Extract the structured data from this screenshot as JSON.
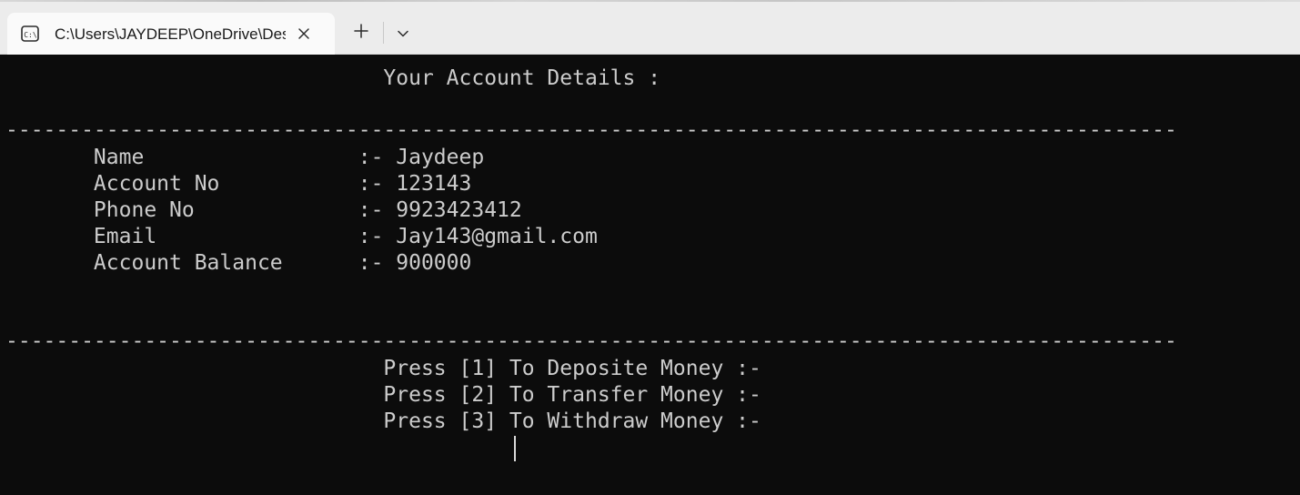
{
  "tab": {
    "title": "C:\\Users\\JAYDEEP\\OneDrive\\Desktop\\bank.exe",
    "icon": "terminal-icon"
  },
  "toolbar": {
    "new_tab_icon": "plus-icon",
    "dropdown_icon": "chevron-down-icon"
  },
  "terminal": {
    "heading": "                              Your Account Details :",
    "divider_char": "-",
    "details": [
      {
        "label": "Name",
        "value": "Jaydeep"
      },
      {
        "label": "Account No",
        "value": "123143"
      },
      {
        "label": "Phone No",
        "value": "9923423412"
      },
      {
        "label": "Email",
        "value": "Jay143@gmail.com"
      },
      {
        "label": "Account Balance",
        "value": "900000"
      }
    ],
    "details_lines": [
      "       Name                 :- Jaydeep",
      "       Account No           :- 123143",
      "       Phone No             :- 9923423412",
      "       Email                :- Jay143@gmail.com",
      "       Account Balance      :- 900000"
    ],
    "menu_lines": [
      "                              Press [1] To Deposite Money :-",
      "                              Press [2] To Transfer Money :-",
      "                              Press [3] To Withdraw Money :-"
    ]
  },
  "colors": {
    "terminal_bg": "#0c0c0c",
    "terminal_fg": "#cccccc",
    "titlebar_bg": "#ececec",
    "tab_bg": "#fafafa"
  }
}
